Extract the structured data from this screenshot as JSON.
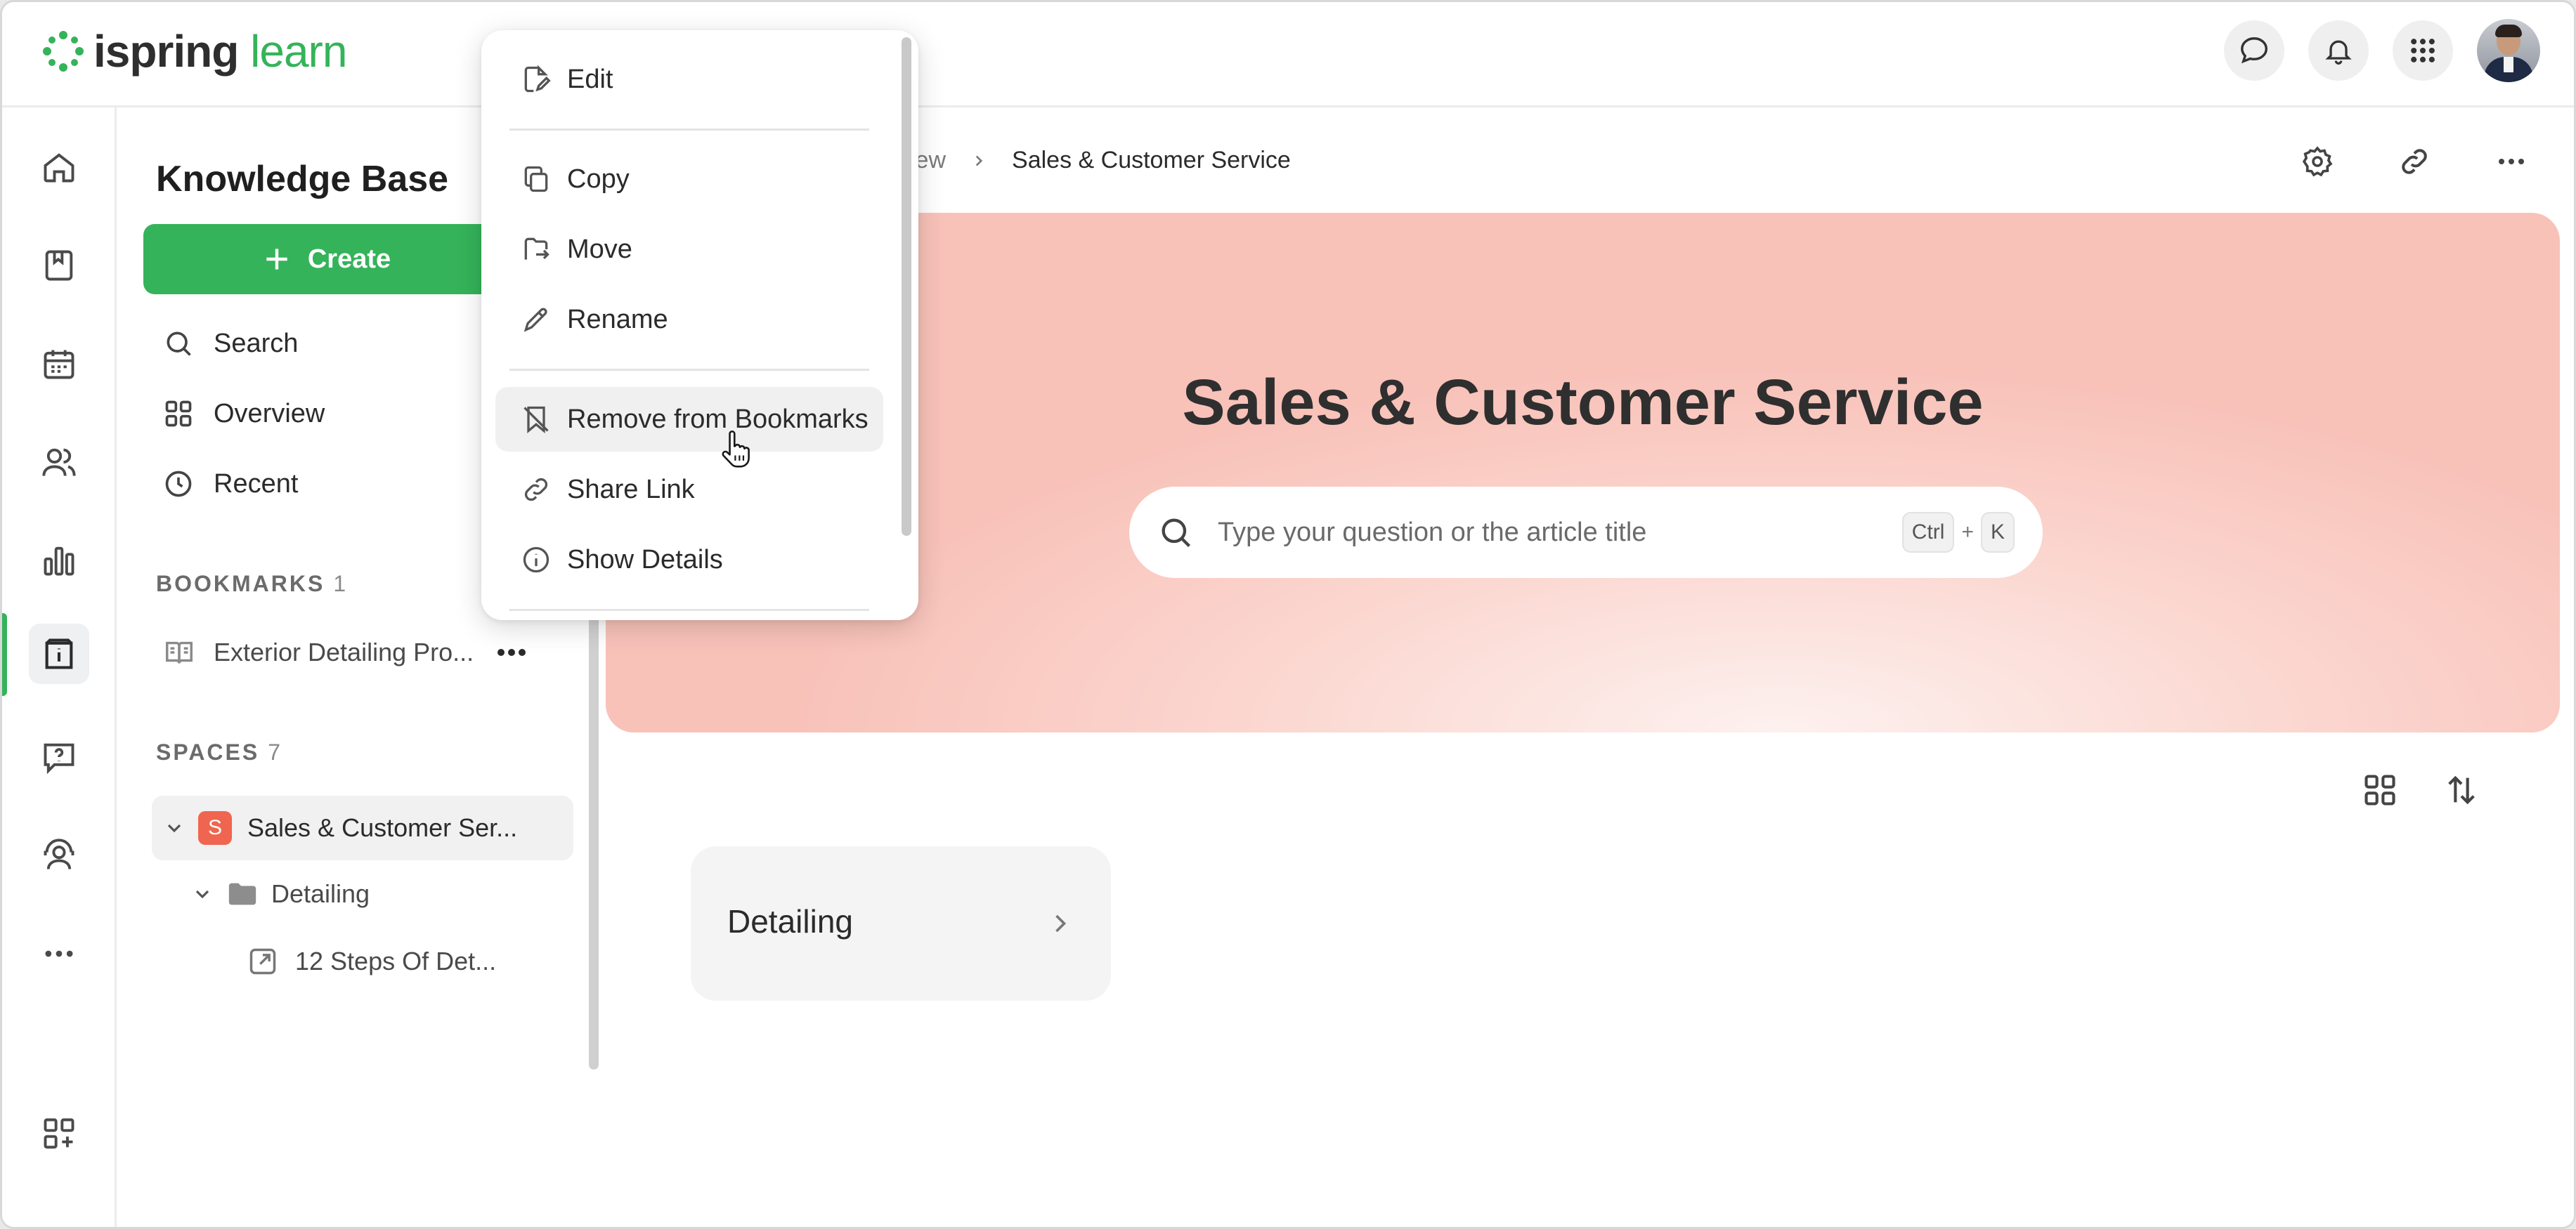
{
  "app": {
    "logo_primary": "ispring",
    "logo_secondary": "learn"
  },
  "colors": {
    "brand_green": "#35b35a",
    "space_badge": "#f0654f",
    "hero_pink": "#f8c2b9"
  },
  "topbar": {
    "icons": [
      "chat-icon",
      "bell-icon",
      "apps-grid-icon",
      "user-avatar"
    ]
  },
  "rail": {
    "items": [
      "home-icon",
      "courses-icon",
      "calendar-icon",
      "users-icon",
      "reports-icon",
      "knowledge-base-icon",
      "qa-icon",
      "support-icon",
      "more-icon",
      "add-widget-icon"
    ],
    "active": "knowledge-base-icon"
  },
  "sidebar": {
    "title": "Knowledge Base",
    "create_label": "Create",
    "nav": [
      {
        "label": "Search",
        "icon": "search-icon"
      },
      {
        "label": "Overview",
        "icon": "grid-icon"
      },
      {
        "label": "Recent",
        "icon": "clock-icon"
      }
    ],
    "bookmarks": {
      "label": "BOOKMARKS",
      "count": "1",
      "items": [
        {
          "label": "Exterior Detailing Pro...",
          "icon": "article-icon"
        }
      ]
    },
    "spaces": {
      "label": "SPACES",
      "count": "7",
      "space": {
        "badge": "S",
        "label": "Sales & Customer Ser..."
      },
      "folder": {
        "label": "Detailing"
      },
      "article": {
        "label": "12 Steps Of Det..."
      }
    }
  },
  "main": {
    "breadcrumb": {
      "prev": "view",
      "current": "Sales & Customer Service"
    },
    "hero": {
      "title": "Sales & Customer Service",
      "search_placeholder": "Type your question or the article title",
      "kbd_ctrl": "Ctrl",
      "kbd_plus": "+",
      "kbd_k": "K"
    },
    "cards": [
      {
        "title": "Detailing"
      }
    ]
  },
  "context_menu": {
    "items": [
      {
        "label": "Edit",
        "icon": "edit-icon"
      },
      {
        "label": "Copy",
        "icon": "copy-icon"
      },
      {
        "label": "Move",
        "icon": "move-icon"
      },
      {
        "label": "Rename",
        "icon": "pencil-icon"
      },
      {
        "label": "Remove from Bookmarks",
        "icon": "bookmark-remove-icon"
      },
      {
        "label": "Share Link",
        "icon": "link-icon"
      },
      {
        "label": "Show Details",
        "icon": "info-icon"
      }
    ],
    "hovered": "Remove from Bookmarks"
  }
}
